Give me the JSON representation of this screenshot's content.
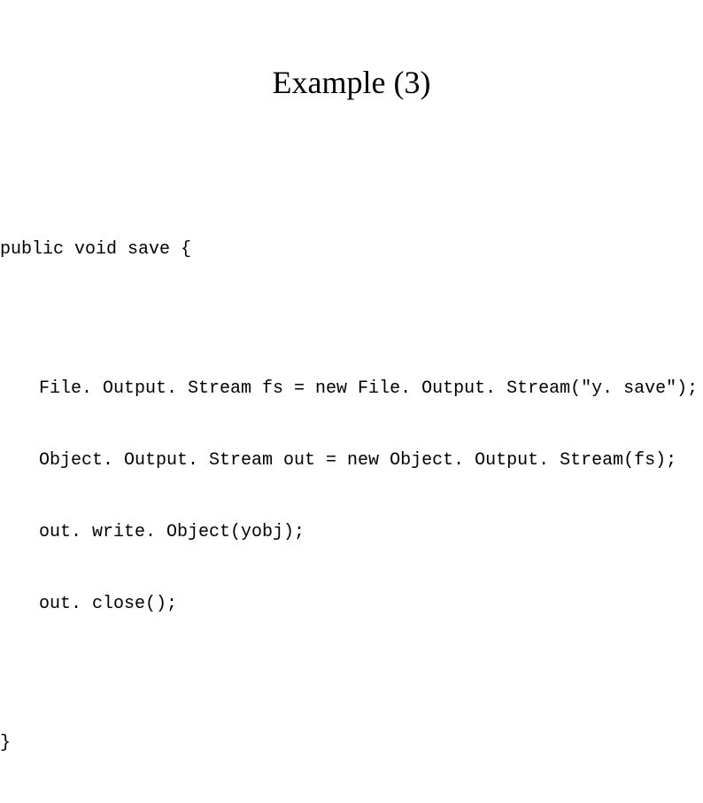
{
  "title": "Example (3)",
  "code": {
    "signature": "public void save {",
    "lines": [
      "File. Output. Stream fs = new File. Output. Stream(\"y. save\");",
      "Object. Output. Stream out = new Object. Output. Stream(fs);",
      "out. write. Object(yobj);",
      "out. close();"
    ],
    "close": "}"
  }
}
